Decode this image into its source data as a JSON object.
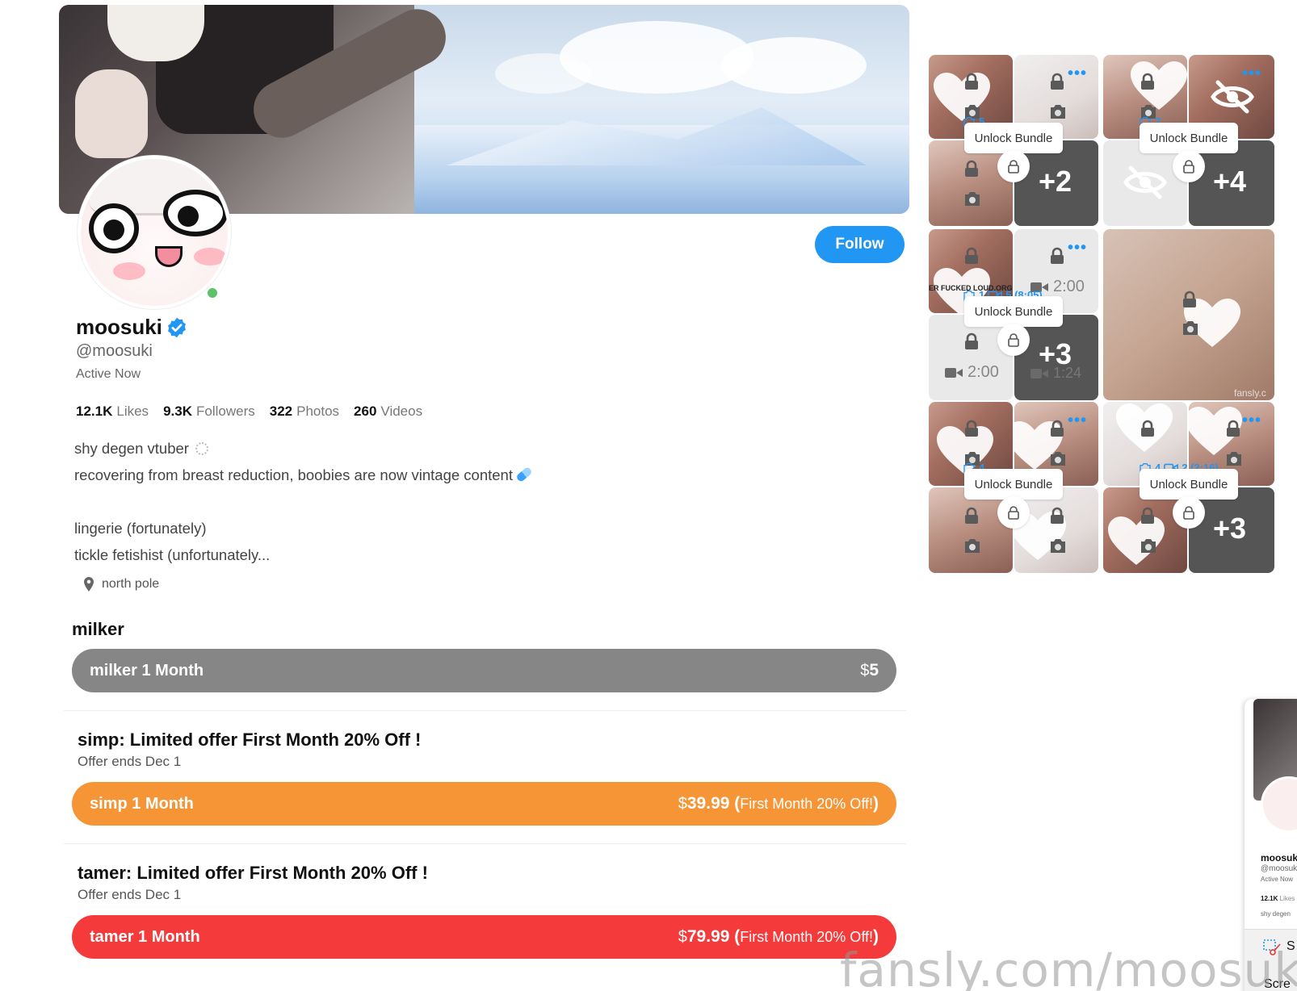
{
  "profile": {
    "display_name": "moosuki",
    "handle": "@moosuki",
    "status": "Active Now",
    "follow_label": "Follow",
    "stats": [
      {
        "value": "12.1K",
        "label": "Likes"
      },
      {
        "value": "9.3K",
        "label": "Followers"
      },
      {
        "value": "322",
        "label": "Photos"
      },
      {
        "value": "260",
        "label": "Videos"
      }
    ],
    "bio": [
      "shy degen vtuber",
      "recovering from breast reduction, boobies are now vintage content",
      "lingerie (fortunately)",
      "tickle fetishist (unfortunately..."
    ],
    "location": "north pole"
  },
  "tiers": {
    "group_title": "milker",
    "milker": {
      "label": "milker 1 Month",
      "currency": "$",
      "price": "5"
    },
    "simp": {
      "offer_title": "simp: Limited offer First Month 20% Off !",
      "offer_ends": "Offer ends Dec 1",
      "label": "simp 1 Month",
      "currency": "$",
      "price": "39.99",
      "note_open": " (",
      "note": "First Month 20% Off!",
      "note_close": ")"
    },
    "tamer": {
      "offer_title": "tamer: Limited offer First Month 20% Off !",
      "offer_ends": "Offer ends Dec 1",
      "label": "tamer 1 Month",
      "currency": "$",
      "price": "79.99",
      "note_open": " (",
      "note": "First Month 20% Off!",
      "note_close": ")"
    }
  },
  "media": {
    "unlock_label": "Unlock Bundle",
    "bundles": [
      {
        "photos": "5"
      },
      {
        "photos": "7"
      },
      {
        "photos": "1",
        "videos": "5 (8:05)"
      },
      {
        "photos": "4"
      },
      {
        "photos": "4",
        "videos": "2 (2:16)"
      }
    ],
    "plus_counts": [
      "+2",
      "+4",
      "+3",
      "+3"
    ],
    "durations": [
      "2:00",
      "2:00",
      "1:24"
    ],
    "tile_text": "ER FUCKED LOUD.ORG",
    "watermark_small": "fansly.c"
  },
  "mini_window": {
    "name": "moosuk",
    "handle": "@moosuk",
    "status": "Active Now",
    "likes": "12.1K",
    "likes_label": "Likes",
    "bio": "shy degen",
    "snip_letter": "S",
    "snip_label": "Scre"
  },
  "watermark": "fansly.com/moosuki",
  "colors": {
    "accent": "#2196f3",
    "tier_gray": "#868686",
    "tier_orange": "#f59535",
    "tier_red": "#f43a3a",
    "online": "#5cc26b"
  }
}
